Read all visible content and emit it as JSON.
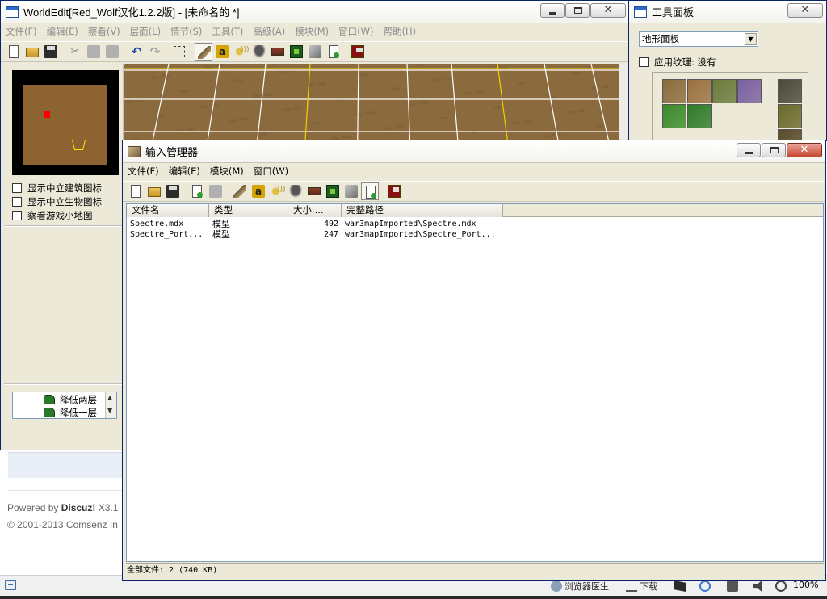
{
  "browser": {
    "powered_prefix": "Powered by ",
    "powered_brand": "Discuz!",
    "powered_version": " X3.1",
    "copyright": "© 2001-2013 Comsenz In",
    "statusbar": {
      "doctor": "浏览器医生",
      "download": "下载",
      "zoom": "100%"
    }
  },
  "main_window": {
    "title": "WorldEdit[Red_Wolf汉化1.2.2版] - [未命名的 *]",
    "menu": [
      "文件(F)",
      "编辑(E)",
      "察看(V)",
      "层面(L)",
      "情节(S)",
      "工具(T)",
      "高级(A)",
      "模块(M)",
      "窗口(W)",
      "帮助(H)"
    ],
    "checkboxes": [
      {
        "label": "显示中立建筑图标",
        "checked": false
      },
      {
        "label": "显示中立生物图标",
        "checked": false
      },
      {
        "label": "察看游戏小地图",
        "checked": false
      }
    ],
    "height_tools": [
      "降低两层",
      "降低一层"
    ],
    "toolbar_icons": [
      "new-file-icon",
      "open-folder-icon",
      "save-icon",
      "cut-icon",
      "copy-icon",
      "paste-icon",
      "undo-icon",
      "redo-icon",
      "select-icon",
      "terrain-editor-icon",
      "doodad-editor-icon",
      "sound-editor-icon",
      "unit-editor-icon",
      "item-editor-icon",
      "ability-editor-icon",
      "import-manager-icon",
      "object-manager-icon",
      "test-map-icon"
    ]
  },
  "palette": {
    "title": "工具面板",
    "dropdown_value": "地形面板",
    "apply_texture_label": "应用纹理: 没有",
    "tile_colors": [
      "#8a6a3c",
      "#9a7040",
      "#6a7a3a",
      "#7a60a0",
      "#4a4a3a",
      "#3a8a2a",
      "#2e7a2a",
      "#6a6a2a",
      "#5a4a2a"
    ]
  },
  "import_manager": {
    "title": "输入管理器",
    "menu": [
      "文件(F)",
      "编辑(E)",
      "模块(M)",
      "窗口(W)"
    ],
    "columns": [
      "文件名",
      "类型",
      "大小 ...",
      "完整路径"
    ],
    "rows": [
      {
        "name": "Spectre.mdx",
        "type": "模型",
        "size": "492",
        "path": "war3mapImported\\Spectre.mdx"
      },
      {
        "name": "Spectre_Port...",
        "type": "模型",
        "size": "247",
        "path": "war3mapImported\\Spectre_Port..."
      }
    ],
    "status": "全部文件: 2 (740 KB)",
    "toolbar_icons": [
      "new-file-icon",
      "open-folder-icon",
      "save-icon",
      "import-file-icon",
      "export-file-icon",
      "terrain-editor-icon",
      "doodad-editor-icon",
      "sound-editor-icon",
      "unit-editor-icon",
      "item-editor-icon",
      "ability-editor-icon",
      "import-manager-icon",
      "object-manager-icon",
      "test-map-icon"
    ]
  },
  "colors": {
    "terrain_dirt": "#8b6a3e",
    "grid_white": "#ffffff",
    "grid_yellow": "#f0d000",
    "minimap_field": "#8d6331",
    "minimap_marker": "#ff0000"
  }
}
